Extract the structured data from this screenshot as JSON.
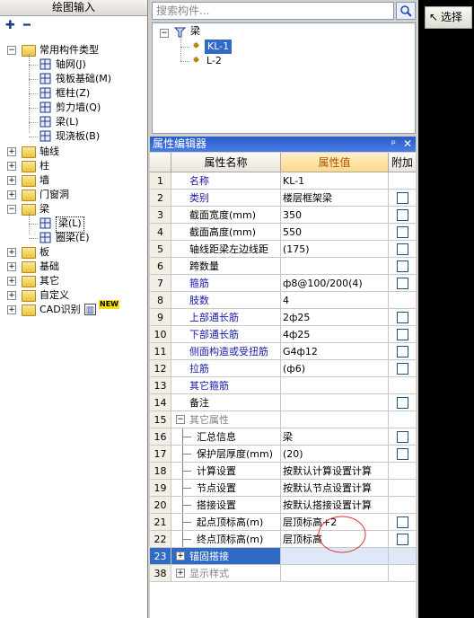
{
  "left_panel": {
    "title": "绘图输入",
    "tree": [
      {
        "label": "常用构件类型",
        "level": 0,
        "expanded": true
      },
      {
        "label": "轴网(J)",
        "level": 1
      },
      {
        "label": "筏板基础(M)",
        "level": 1
      },
      {
        "label": "框柱(Z)",
        "level": 1
      },
      {
        "label": "剪力墙(Q)",
        "level": 1
      },
      {
        "label": "梁(L)",
        "level": 1
      },
      {
        "label": "现浇板(B)",
        "level": 1
      },
      {
        "label": "轴线",
        "level": 0
      },
      {
        "label": "柱",
        "level": 0
      },
      {
        "label": "墙",
        "level": 0
      },
      {
        "label": "门窗洞",
        "level": 0
      },
      {
        "label": "梁",
        "level": 0,
        "expanded": true
      },
      {
        "label": "梁(L)",
        "level": 1,
        "selected": true
      },
      {
        "label": "圈梁(E)",
        "level": 1
      },
      {
        "label": "板",
        "level": 0
      },
      {
        "label": "基础",
        "level": 0
      },
      {
        "label": "其它",
        "level": 0
      },
      {
        "label": "自定义",
        "level": 0
      },
      {
        "label": "CAD识别",
        "level": 0,
        "badge": "NEW"
      }
    ]
  },
  "search": {
    "placeholder": "搜索构件..."
  },
  "component_tree": {
    "root": "梁",
    "items": [
      {
        "label": "KL-1",
        "selected": true
      },
      {
        "label": "L-2",
        "selected": false
      }
    ]
  },
  "property_editor": {
    "title": "属性编辑器",
    "pin_icon": "pin-icon",
    "columns": {
      "name": "属性名称",
      "value": "属性值",
      "extra": "附加"
    },
    "rows": [
      {
        "num": "1",
        "name": "名称",
        "value": "KL-1",
        "style": "blue",
        "checkbox": false
      },
      {
        "num": "2",
        "name": "类别",
        "value": "楼层框架梁",
        "style": "blue",
        "checkbox": true
      },
      {
        "num": "3",
        "name": "截面宽度(mm)",
        "value": "350",
        "style": "normal",
        "checkbox": true
      },
      {
        "num": "4",
        "name": "截面高度(mm)",
        "value": "550",
        "style": "normal",
        "checkbox": true
      },
      {
        "num": "5",
        "name": "轴线距梁左边线距",
        "value": "(175)",
        "style": "normal",
        "checkbox": true
      },
      {
        "num": "6",
        "name": "跨数量",
        "value": "",
        "style": "normal",
        "checkbox": true
      },
      {
        "num": "7",
        "name": "箍筋",
        "value": "ф8@100/200(4)",
        "style": "blue",
        "checkbox": true
      },
      {
        "num": "8",
        "name": "肢数",
        "value": "4",
        "style": "blue",
        "checkbox": false
      },
      {
        "num": "9",
        "name": "上部通长筋",
        "value": "2ф25",
        "style": "blue",
        "checkbox": true
      },
      {
        "num": "10",
        "name": "下部通长筋",
        "value": "4ф25",
        "style": "blue",
        "checkbox": true
      },
      {
        "num": "11",
        "name": "侧面构造或受扭筋",
        "value": "G4ф12",
        "style": "blue",
        "checkbox": true
      },
      {
        "num": "12",
        "name": "拉筋",
        "value": "(ф6)",
        "style": "blue",
        "checkbox": true
      },
      {
        "num": "13",
        "name": "其它箍筋",
        "value": "",
        "style": "blue",
        "checkbox": false
      },
      {
        "num": "14",
        "name": "备注",
        "value": "",
        "style": "normal",
        "checkbox": true
      },
      {
        "num": "15",
        "name": "其它属性",
        "value": "",
        "style": "group",
        "checkbox": false
      },
      {
        "num": "16",
        "name": "汇总信息",
        "value": "梁",
        "style": "child",
        "checkbox": true
      },
      {
        "num": "17",
        "name": "保护层厚度(mm)",
        "value": "(20)",
        "style": "child",
        "checkbox": true
      },
      {
        "num": "18",
        "name": "计算设置",
        "value": "按默认计算设置计算",
        "style": "child",
        "checkbox": false
      },
      {
        "num": "19",
        "name": "节点设置",
        "value": "按默认节点设置计算",
        "style": "child",
        "checkbox": false
      },
      {
        "num": "20",
        "name": "搭接设置",
        "value": "按默认搭接设置计算",
        "style": "child",
        "checkbox": false
      },
      {
        "num": "21",
        "name": "起点顶标高(m)",
        "value": "层顶标高+2",
        "style": "child",
        "checkbox": true
      },
      {
        "num": "22",
        "name": "终点顶标高(m)",
        "value": "层顶标高",
        "style": "child",
        "checkbox": true
      },
      {
        "num": "23",
        "name": "锚固搭接",
        "value": "",
        "style": "selected",
        "checkbox": false
      },
      {
        "num": "38",
        "name": "显示样式",
        "value": "",
        "style": "group",
        "checkbox": false
      }
    ]
  },
  "right_toolbar": {
    "select_label": "选择"
  },
  "colors": {
    "title_bar": "#2a5cc8",
    "selected_row": "#316ac5",
    "label_blue": "#1a1aa8",
    "highlight_header": "#ffe8b0"
  }
}
